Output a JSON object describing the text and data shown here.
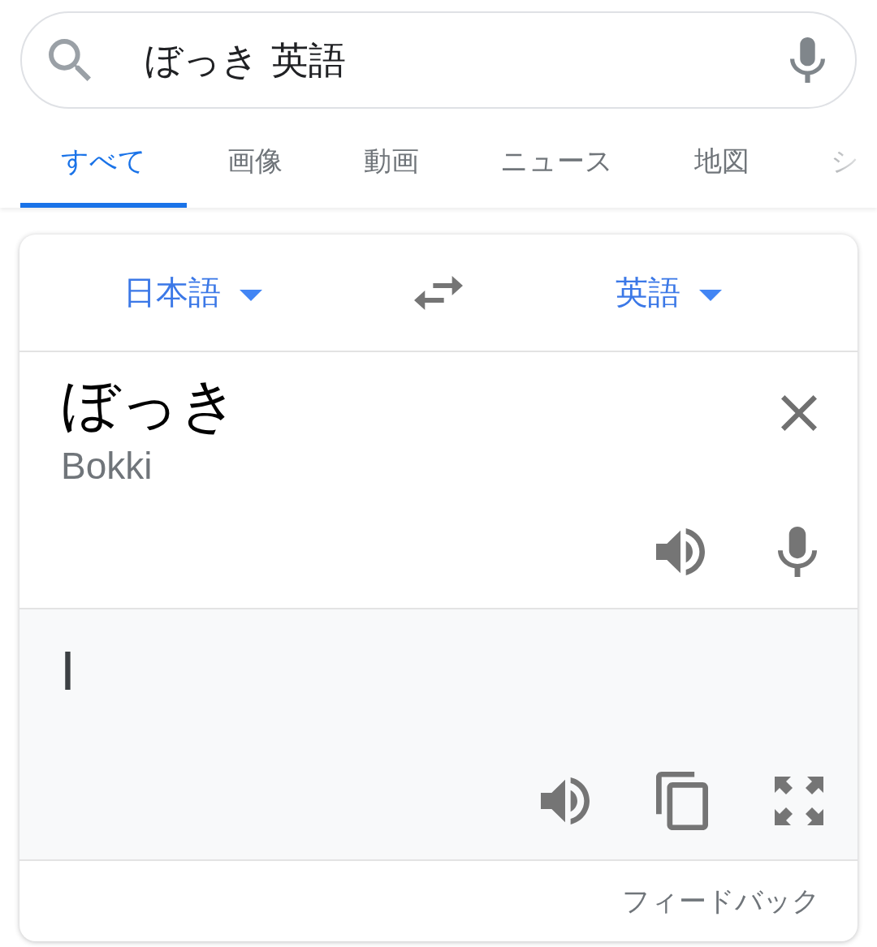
{
  "search": {
    "query": "ぼっき 英語"
  },
  "tabs": [
    {
      "label": "すべて",
      "selected": true
    },
    {
      "label": "画像",
      "selected": false
    },
    {
      "label": "動画",
      "selected": false
    },
    {
      "label": "ニュース",
      "selected": false
    },
    {
      "label": "地図",
      "selected": false
    },
    {
      "label": "シ",
      "selected": false
    }
  ],
  "translator": {
    "source_language": "日本語",
    "target_language": "英語",
    "source_text": "ぼっき",
    "romanization": "Bokki",
    "translation": "I",
    "feedback": "フィードバック"
  }
}
